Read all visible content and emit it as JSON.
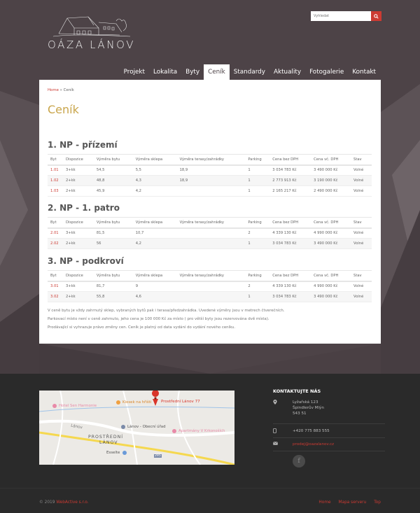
{
  "brand": {
    "name": "OÁZA LÁNOV"
  },
  "search": {
    "placeholder": "Vyhledat"
  },
  "nav": {
    "items": [
      "Projekt",
      "Lokalita",
      "Byty",
      "Ceník",
      "Standardy",
      "Aktuality",
      "Fotogalerie",
      "Kontakt"
    ],
    "active": "Ceník"
  },
  "breadcrumb": {
    "home": "Home",
    "separator": "»",
    "current": "Ceník"
  },
  "page": {
    "title": "Ceník"
  },
  "columns": [
    "Byt",
    "Dispozice",
    "Výměra bytu",
    "Výměra sklepa",
    "Výměra terasy/zahrádky",
    "Parking",
    "Cena bez DPH",
    "Cena vč. DPH",
    "Stav"
  ],
  "sections": [
    {
      "title": "1. NP - přízemí",
      "rows": [
        [
          "1.01",
          "3+kk",
          "54,5",
          "5,5",
          "18,9",
          "1",
          "3 034 783 Kč",
          "3 490 000 Kč",
          "Volné"
        ],
        [
          "1.02",
          "2+kk",
          "48,8",
          "4,3",
          "18,9",
          "1",
          "2 773 913 Kč",
          "3 190 000 Kč",
          "Volné"
        ],
        [
          "1.03",
          "2+kk",
          "45,9",
          "4,2",
          "",
          "1",
          "2 165 217 Kč",
          "2 490 000 Kč",
          "Volné"
        ]
      ]
    },
    {
      "title": "2. NP - 1. patro",
      "rows": [
        [
          "2.01",
          "3+kk",
          "81,5",
          "10,7",
          "",
          "2",
          "4 339 130 Kč",
          "4 990 000 Kč",
          "Volné"
        ],
        [
          "2.02",
          "2+kk",
          "56",
          "4,2",
          "",
          "1",
          "3 034 783 Kč",
          "3 490 000 Kč",
          "Volné"
        ]
      ]
    },
    {
      "title": "3. NP - podkroví",
      "rows": [
        [
          "3.01",
          "3+kk",
          "81,7",
          "9",
          "",
          "2",
          "4 339 130 Kč",
          "4 990 000 Kč",
          "Volné"
        ],
        [
          "3.02",
          "2+kk",
          "55,8",
          "4,6",
          "",
          "1",
          "3 034 783 Kč",
          "3 490 000 Kč",
          "Volné"
        ]
      ]
    }
  ],
  "notes": [
    "V ceně bytu je vždy zahrnutý sklep, vybraných bytů pak i terasa/předzahrádka. Uvedené výměry jsou v metrech čtverečních.",
    "Parkovací místo není v ceně zahrnuto, jeho cena je 100 000 Kč za místo ( pro větší byty jsou rezervována dvě místa).",
    "Prodávající si vyhrazuje právo změny cen. Ceník je platný od data vydání do vydání nového ceníku."
  ],
  "map": {
    "pin_label": "Prostřední Lánov 77",
    "places": [
      "Hotel Sen Harmonie",
      "Kiosek na hřišti",
      "Lánov - Obecní úřad",
      "Apartmány V Krkonoších",
      "PROSTŘEDNÍ",
      "LÁNOV",
      "Lánov",
      "Esselte",
      "295"
    ]
  },
  "contact": {
    "title": "KONTAKTUJTE NÁS",
    "address": [
      "Lyžařská 123",
      "Špindlerův Mlýn",
      "543 51"
    ],
    "phone": "+420 775 883 555",
    "email": "prodej@oazalanov.cz",
    "social": "f"
  },
  "footer": {
    "copyright_prefix": "© 2019",
    "company": "WebActive s.r.o.",
    "links": [
      "Home",
      "Mapa serveru",
      "Top"
    ]
  },
  "colors": {
    "accent": "#cc3a32",
    "gold": "#c9a54b",
    "bg": "#4d4347",
    "footer": "#2a2a2a"
  }
}
